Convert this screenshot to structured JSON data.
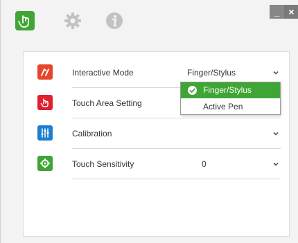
{
  "window": {
    "minimize_label": "_",
    "close_label": "×"
  },
  "toolbar": {
    "icons": [
      "hand-pointer-icon",
      "gear-icon",
      "info-icon"
    ]
  },
  "settings": {
    "rows": [
      {
        "label": "Interactive Mode",
        "value": "Finger/Stylus",
        "icon": "pen-touch-icon",
        "icon_color": "#e8452c"
      },
      {
        "label": "Touch Area Setting",
        "value": "",
        "icon": "hand-touch-icon",
        "icon_color": "#e0202f"
      },
      {
        "label": "Calibration",
        "value": "",
        "icon": "sliders-icon",
        "icon_color": "#1f7fcf"
      },
      {
        "label": "Touch Sensitivity",
        "value": "0",
        "icon": "gear-touch-icon",
        "icon_color": "#3fa535"
      }
    ]
  },
  "dropdown": {
    "options": [
      {
        "label": "Finger/Stylus",
        "selected": true
      },
      {
        "label": "Active Pen",
        "selected": false
      }
    ]
  },
  "colors": {
    "accent_green": "#3fa535",
    "icon_gray": "#c2c2c2"
  }
}
